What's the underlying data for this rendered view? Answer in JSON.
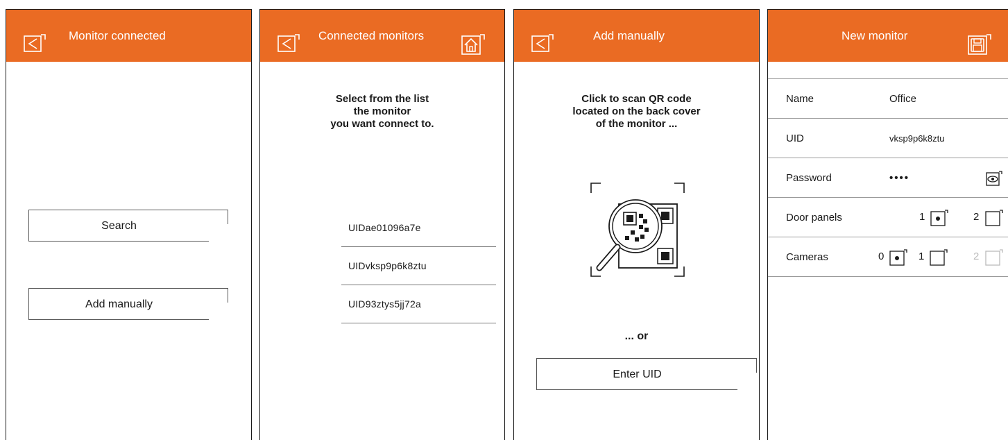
{
  "panels": {
    "monitor_connected": {
      "title": "Monitor connected",
      "search_label": "Search",
      "add_manually_label": "Add manually"
    },
    "connected_monitors": {
      "title": "Connected monitors",
      "prompt": [
        "Select from the list",
        "the monitor",
        "you want connect to."
      ],
      "items": [
        "UIDae01096a7e",
        "UIDvksp9p6k8ztu",
        "UID93ztys5jj72a"
      ]
    },
    "add_manually": {
      "title": "Add manually",
      "prompt": [
        "Click to scan QR code",
        "located on the back cover",
        "of the monitor ..."
      ],
      "or_text": "... or",
      "enter_uid_label": "Enter UID"
    },
    "new_monitor": {
      "title": "New monitor",
      "name_label": "Name",
      "name_value": "Office",
      "uid_label": "UID",
      "uid_value": "vksp9p6k8ztu",
      "password_label": "Password",
      "password_value": "••••",
      "door_panels_label": "Door panels",
      "door_panel_options": [
        "1",
        "2"
      ],
      "door_panels_selected": "1",
      "cameras_label": "Cameras",
      "camera_options": [
        "0",
        "1",
        "2"
      ],
      "cameras_selected": "0"
    }
  },
  "colors": {
    "header": "#ea6b23",
    "header_text": "#ffffff",
    "text": "#1a1a1a",
    "disabled": "#bbbbbb"
  },
  "icons": {
    "back": "back-arrow-icon",
    "home": "home-icon",
    "save": "save-icon",
    "eye": "eye-icon",
    "qr": "qr-scan-magnifier-icon"
  }
}
